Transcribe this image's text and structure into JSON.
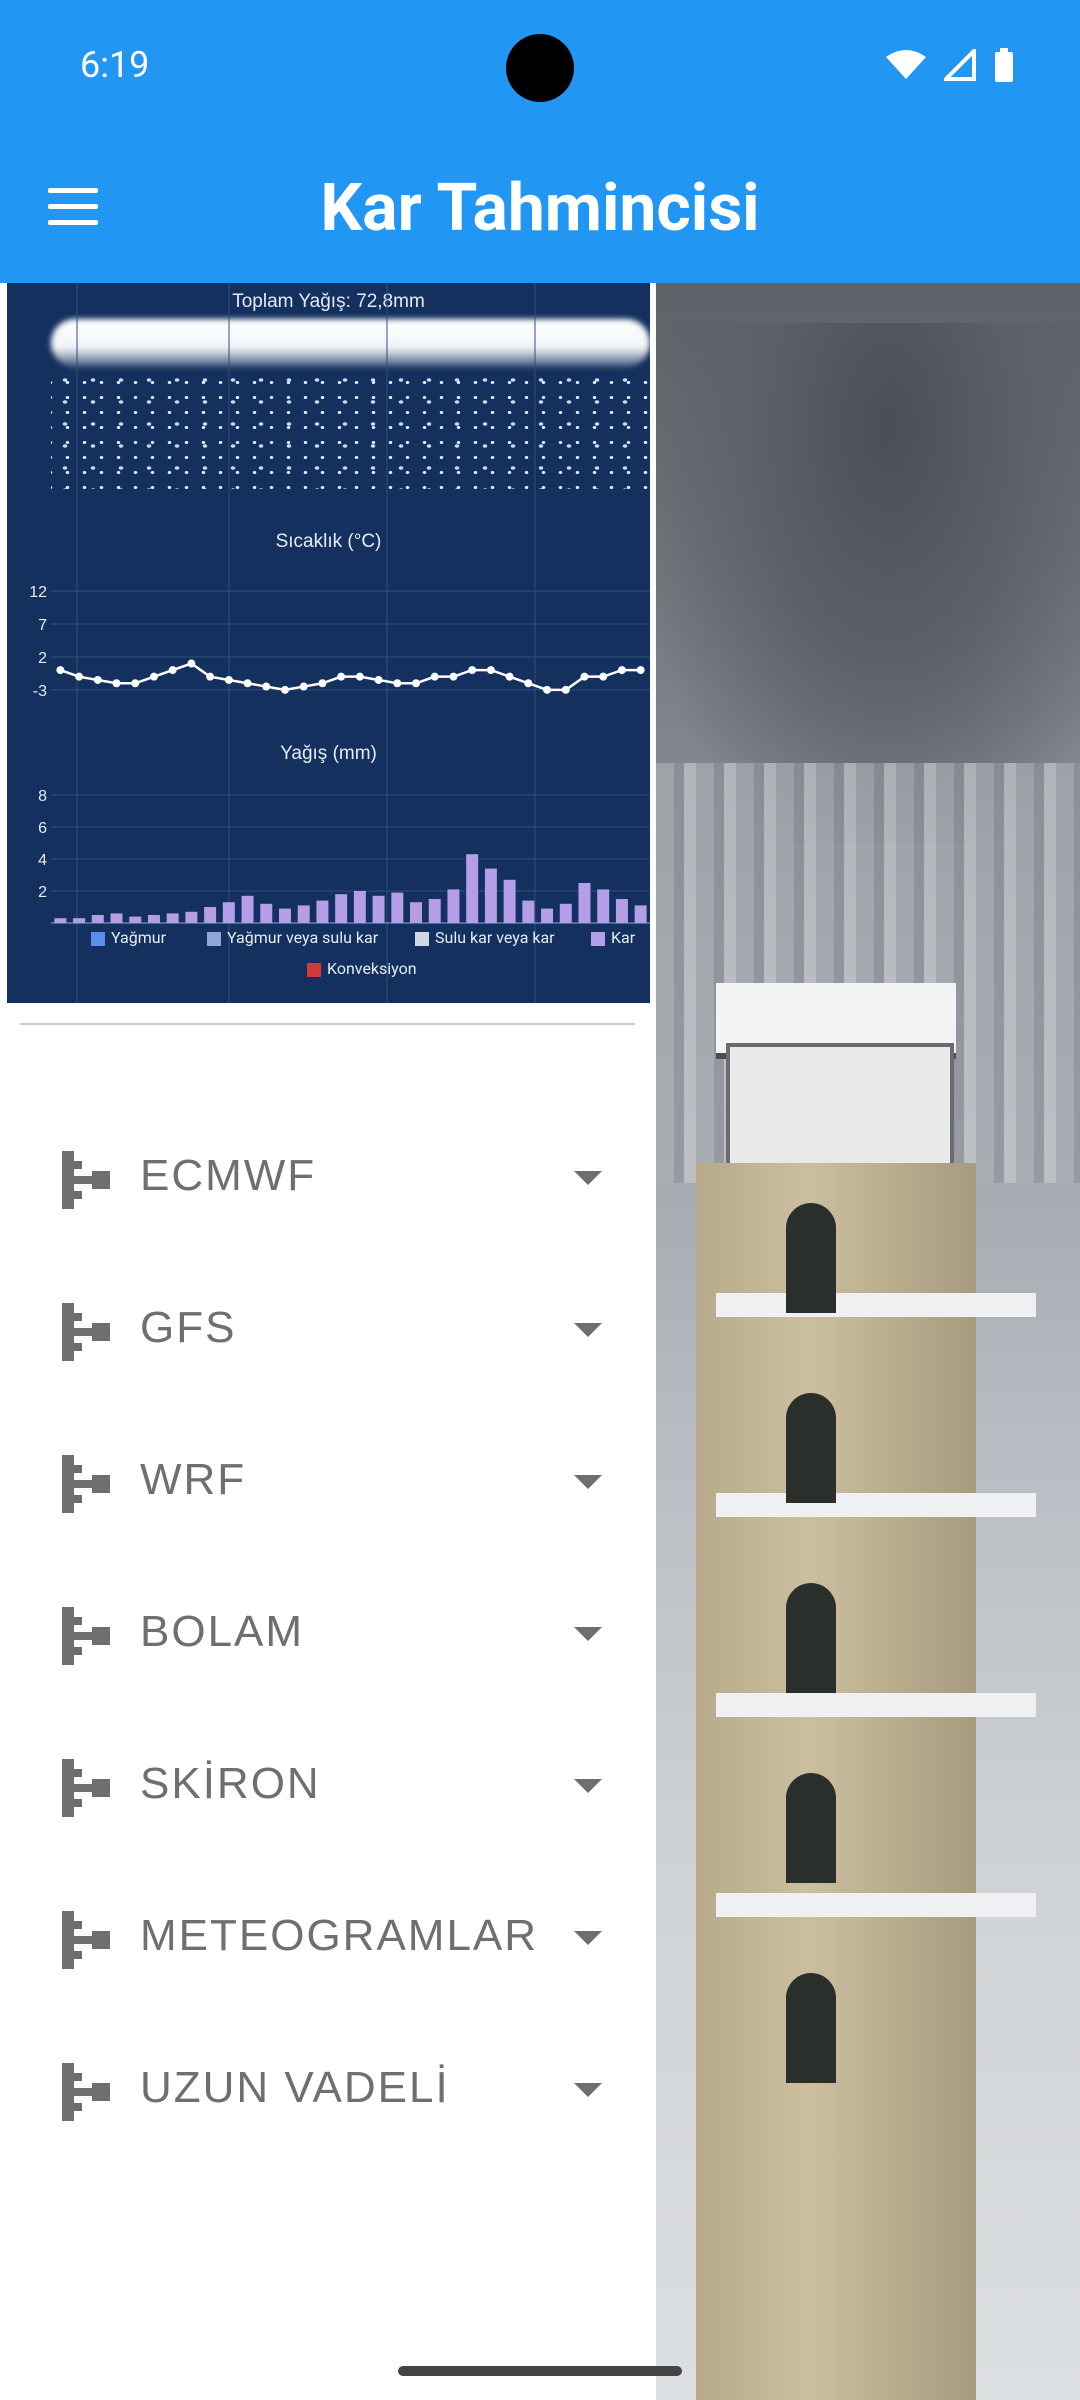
{
  "status_bar": {
    "time": "6:19"
  },
  "app_bar": {
    "title": "Kar Tahmincisi",
    "menu_icon": "hamburger-menu-icon"
  },
  "chart_data": {
    "type": "bar",
    "title": "Toplam Yağış: 72,8mm",
    "temperature": {
      "label": "Sıcaklık (°C)",
      "yticks": [
        12,
        7,
        2,
        -3
      ],
      "values": [
        0,
        -1,
        -1.5,
        -2,
        -2,
        -1,
        0,
        1,
        -1,
        -1.5,
        -2,
        -2.5,
        -3,
        -2.5,
        -2,
        -1,
        -1,
        -1.5,
        -2,
        -2,
        -1,
        -1,
        0,
        0,
        -1,
        -2,
        -3,
        -3,
        -1,
        -1,
        0,
        0
      ]
    },
    "precipitation": {
      "label": "Yağış (mm)",
      "yticks": [
        8,
        6,
        4,
        2
      ],
      "values": [
        0.3,
        0.3,
        0.5,
        0.6,
        0.4,
        0.5,
        0.6,
        0.7,
        1.0,
        1.3,
        1.7,
        1.2,
        0.9,
        1.1,
        1.4,
        1.8,
        2.0,
        1.7,
        1.9,
        1.3,
        1.5,
        2.1,
        4.3,
        3.4,
        2.7,
        1.4,
        0.9,
        1.2,
        2.5,
        2.1,
        1.5,
        1.1
      ],
      "ylim": [
        0,
        8
      ]
    },
    "legend": [
      "Yağmur",
      "Yağmur veya sulu kar",
      "Sulu kar veya kar",
      "Kar",
      "Konveksiyon"
    ],
    "legend_colors": [
      "#5b8def",
      "#8fa6d8",
      "#cfd6e6",
      "#b49ee8",
      "#d23a3a"
    ]
  },
  "nav": {
    "items": [
      {
        "label": "ECMWF",
        "icon": "tree-structure-icon"
      },
      {
        "label": "GFS",
        "icon": "tree-structure-icon"
      },
      {
        "label": "WRF",
        "icon": "tree-structure-icon"
      },
      {
        "label": "BOLAM",
        "icon": "tree-structure-icon"
      },
      {
        "label": "SKİRON",
        "icon": "tree-structure-icon"
      },
      {
        "label": "METEOGRAMLAR",
        "icon": "tree-structure-icon"
      },
      {
        "label": "UZUN VADELİ",
        "icon": "tree-structure-icon"
      }
    ]
  },
  "colors": {
    "primary": "#2196f3",
    "chart_bg": "#13305e",
    "nav_text": "#6f6f6f"
  }
}
